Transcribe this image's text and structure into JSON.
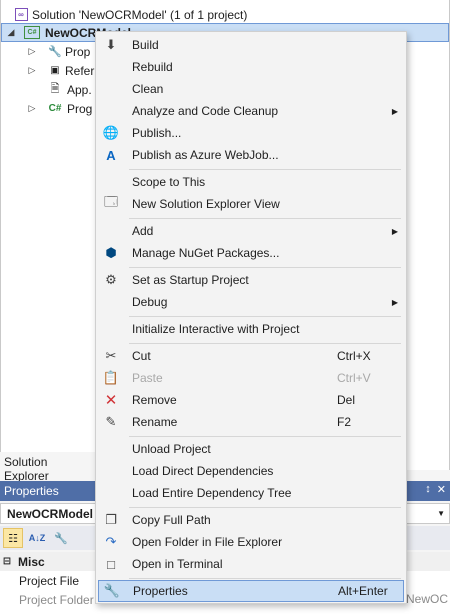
{
  "solution_explorer": {
    "solution_label": "Solution 'NewOCRModel' (1 of 1 project)",
    "project_label": "NewOCRModel",
    "children": [
      {
        "label": "Properties",
        "icon": "wrench-icon"
      },
      {
        "label": "References",
        "icon": "references-icon"
      },
      {
        "label": "App.config",
        "icon": "config-file-icon"
      },
      {
        "label": "Program.cs",
        "icon": "csharp-file-icon"
      }
    ],
    "visible_child_labels": [
      "Prop",
      "Refer",
      "App.",
      "Prog"
    ],
    "tab_label": "Solution Explorer"
  },
  "properties_window": {
    "title": "Properties",
    "pin_glyph": "↕",
    "close_glyph": "✕",
    "object_name": "NewOCRModel",
    "category": "Misc",
    "rows": [
      "Project File",
      "Project Folder"
    ],
    "value_peek": "NewOC"
  },
  "context_menu": {
    "items": {
      "build": "Build",
      "rebuild": "Rebuild",
      "clean": "Clean",
      "analyze": "Analyze and Code Cleanup",
      "publish": "Publish...",
      "publish_azure": "Publish as Azure WebJob...",
      "scope": "Scope to This",
      "new_view": "New Solution Explorer View",
      "add": "Add",
      "nuget": "Manage NuGet Packages...",
      "startup": "Set as Startup Project",
      "debug": "Debug",
      "interactive": "Initialize Interactive with Project",
      "cut": "Cut",
      "paste": "Paste",
      "remove": "Remove",
      "rename": "Rename",
      "unload": "Unload Project",
      "load_direct": "Load Direct Dependencies",
      "load_tree": "Load Entire Dependency Tree",
      "copy_path": "Copy Full Path",
      "open_folder": "Open Folder in File Explorer",
      "open_terminal": "Open in Terminal",
      "properties": "Properties"
    },
    "shortcuts": {
      "cut": "Ctrl+X",
      "paste": "Ctrl+V",
      "remove": "Del",
      "rename": "F2",
      "properties": "Alt+Enter"
    },
    "disabled": [
      "paste"
    ],
    "highlighted": "properties"
  },
  "colors": {
    "selection": "#c9def5",
    "selection_border": "#6f99d6",
    "properties_titlebar": "#4f6ea7",
    "menu_background": "#f3f3f3"
  }
}
